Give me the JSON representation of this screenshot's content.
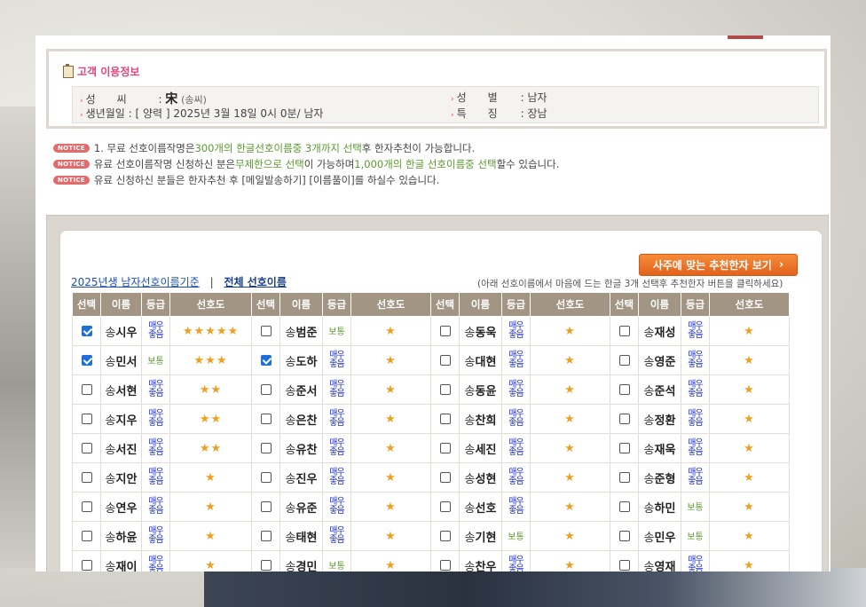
{
  "info": {
    "title": "고객 이용정보",
    "surname_label": "성　　씨",
    "surname_value": "宋",
    "surname_reading": "(송씨)",
    "birth_label": "생년월일",
    "birth_value": ": [ 양력 ] 2025년 3월 18일 0시 0분/ 남자",
    "gender_label": "성　　별",
    "gender_value": ": 남자",
    "feature_label": "특　　징",
    "feature_value": ": 장남"
  },
  "notices": {
    "badge": "NOTICE",
    "n1_a": "1. 무료 선호이름작명은 ",
    "n1_b": "300개의 한글선호이름중 3개까지 선택",
    "n1_c": "후 한자추천이 가능합니다.",
    "n2_a": "유료 선호이름작명 신청하신 분은",
    "n2_b": "무제한으로 선택",
    "n2_c": "이 가능하며 ",
    "n2_d": "1,000개의 한글 선호이름중 선택",
    "n2_e": "할수 있습니다.",
    "n3": "유료 신청하신 분들은 한자추천 후 [메일발송하기] [이름풀이]를 하실수 있습니다."
  },
  "controls": {
    "recommend_button": "사주에 맞는 추천한자 보기",
    "tab_year": "2025년생 남자선호이름기준",
    "tab_sep": "|",
    "tab_all": "전체 선호이름",
    "hint": "(아래 선호이름에서 마음에 드는 한글 3개 선택후 추천한자 버튼을 클릭하세요)"
  },
  "table": {
    "headers": [
      "선택",
      "이름",
      "등급",
      "선호도"
    ],
    "grade_very": "매우\n좋음",
    "grade_good": "보통",
    "rows": [
      [
        {
          "s": "송",
          "g": "시우",
          "checked": true,
          "grade": "very",
          "stars": "★★★★★"
        },
        {
          "s": "송",
          "g": "범준",
          "checked": false,
          "grade": "good",
          "stars": "★"
        },
        {
          "s": "송",
          "g": "동욱",
          "checked": false,
          "grade": "very",
          "stars": "★"
        },
        {
          "s": "송",
          "g": "재성",
          "checked": false,
          "grade": "very",
          "stars": "★"
        }
      ],
      [
        {
          "s": "송",
          "g": "민서",
          "checked": true,
          "grade": "good",
          "stars": "★★★"
        },
        {
          "s": "송",
          "g": "도하",
          "checked": true,
          "grade": "very",
          "stars": "★"
        },
        {
          "s": "송",
          "g": "대현",
          "checked": false,
          "grade": "very",
          "stars": "★"
        },
        {
          "s": "송",
          "g": "영준",
          "checked": false,
          "grade": "very",
          "stars": "★"
        }
      ],
      [
        {
          "s": "송",
          "g": "서현",
          "checked": false,
          "grade": "very",
          "stars": "★★"
        },
        {
          "s": "송",
          "g": "준서",
          "checked": false,
          "grade": "very",
          "stars": "★"
        },
        {
          "s": "송",
          "g": "동윤",
          "checked": false,
          "grade": "very",
          "stars": "★"
        },
        {
          "s": "송",
          "g": "준석",
          "checked": false,
          "grade": "very",
          "stars": "★"
        }
      ],
      [
        {
          "s": "송",
          "g": "지우",
          "checked": false,
          "grade": "very",
          "stars": "★★"
        },
        {
          "s": "송",
          "g": "은찬",
          "checked": false,
          "grade": "very",
          "stars": "★"
        },
        {
          "s": "송",
          "g": "찬희",
          "checked": false,
          "grade": "very",
          "stars": "★"
        },
        {
          "s": "송",
          "g": "정환",
          "checked": false,
          "grade": "very",
          "stars": "★"
        }
      ],
      [
        {
          "s": "송",
          "g": "서진",
          "checked": false,
          "grade": "very",
          "stars": "★★"
        },
        {
          "s": "송",
          "g": "유찬",
          "checked": false,
          "grade": "very",
          "stars": "★"
        },
        {
          "s": "송",
          "g": "세진",
          "checked": false,
          "grade": "very",
          "stars": "★"
        },
        {
          "s": "송",
          "g": "재욱",
          "checked": false,
          "grade": "very",
          "stars": "★"
        }
      ],
      [
        {
          "s": "송",
          "g": "지안",
          "checked": false,
          "grade": "very",
          "stars": "★"
        },
        {
          "s": "송",
          "g": "진우",
          "checked": false,
          "grade": "very",
          "stars": "★"
        },
        {
          "s": "송",
          "g": "성현",
          "checked": false,
          "grade": "very",
          "stars": "★"
        },
        {
          "s": "송",
          "g": "준형",
          "checked": false,
          "grade": "very",
          "stars": "★"
        }
      ],
      [
        {
          "s": "송",
          "g": "연우",
          "checked": false,
          "grade": "very",
          "stars": "★"
        },
        {
          "s": "송",
          "g": "유준",
          "checked": false,
          "grade": "very",
          "stars": "★"
        },
        {
          "s": "송",
          "g": "선호",
          "checked": false,
          "grade": "very",
          "stars": "★"
        },
        {
          "s": "송",
          "g": "하민",
          "checked": false,
          "grade": "good",
          "stars": "★"
        }
      ],
      [
        {
          "s": "송",
          "g": "하윤",
          "checked": false,
          "grade": "very",
          "stars": "★"
        },
        {
          "s": "송",
          "g": "태현",
          "checked": false,
          "grade": "very",
          "stars": "★"
        },
        {
          "s": "송",
          "g": "기현",
          "checked": false,
          "grade": "good",
          "stars": "★"
        },
        {
          "s": "송",
          "g": "민우",
          "checked": false,
          "grade": "good",
          "stars": "★"
        }
      ],
      [
        {
          "s": "송",
          "g": "재이",
          "checked": false,
          "grade": "very",
          "stars": "★"
        },
        {
          "s": "송",
          "g": "경민",
          "checked": false,
          "grade": "good",
          "stars": "★"
        },
        {
          "s": "송",
          "g": "찬우",
          "checked": false,
          "grade": "very",
          "stars": "★"
        },
        {
          "s": "송",
          "g": "영재",
          "checked": false,
          "grade": "very",
          "stars": "★"
        }
      ]
    ]
  },
  "colors": {
    "accent": "#e0457b",
    "button": "#e2621c",
    "header": "#a39584",
    "check": "#1e6fd9",
    "grade_very": "#1c2fd0",
    "grade_good": "#5a9a2e",
    "star": "#f0a020"
  }
}
